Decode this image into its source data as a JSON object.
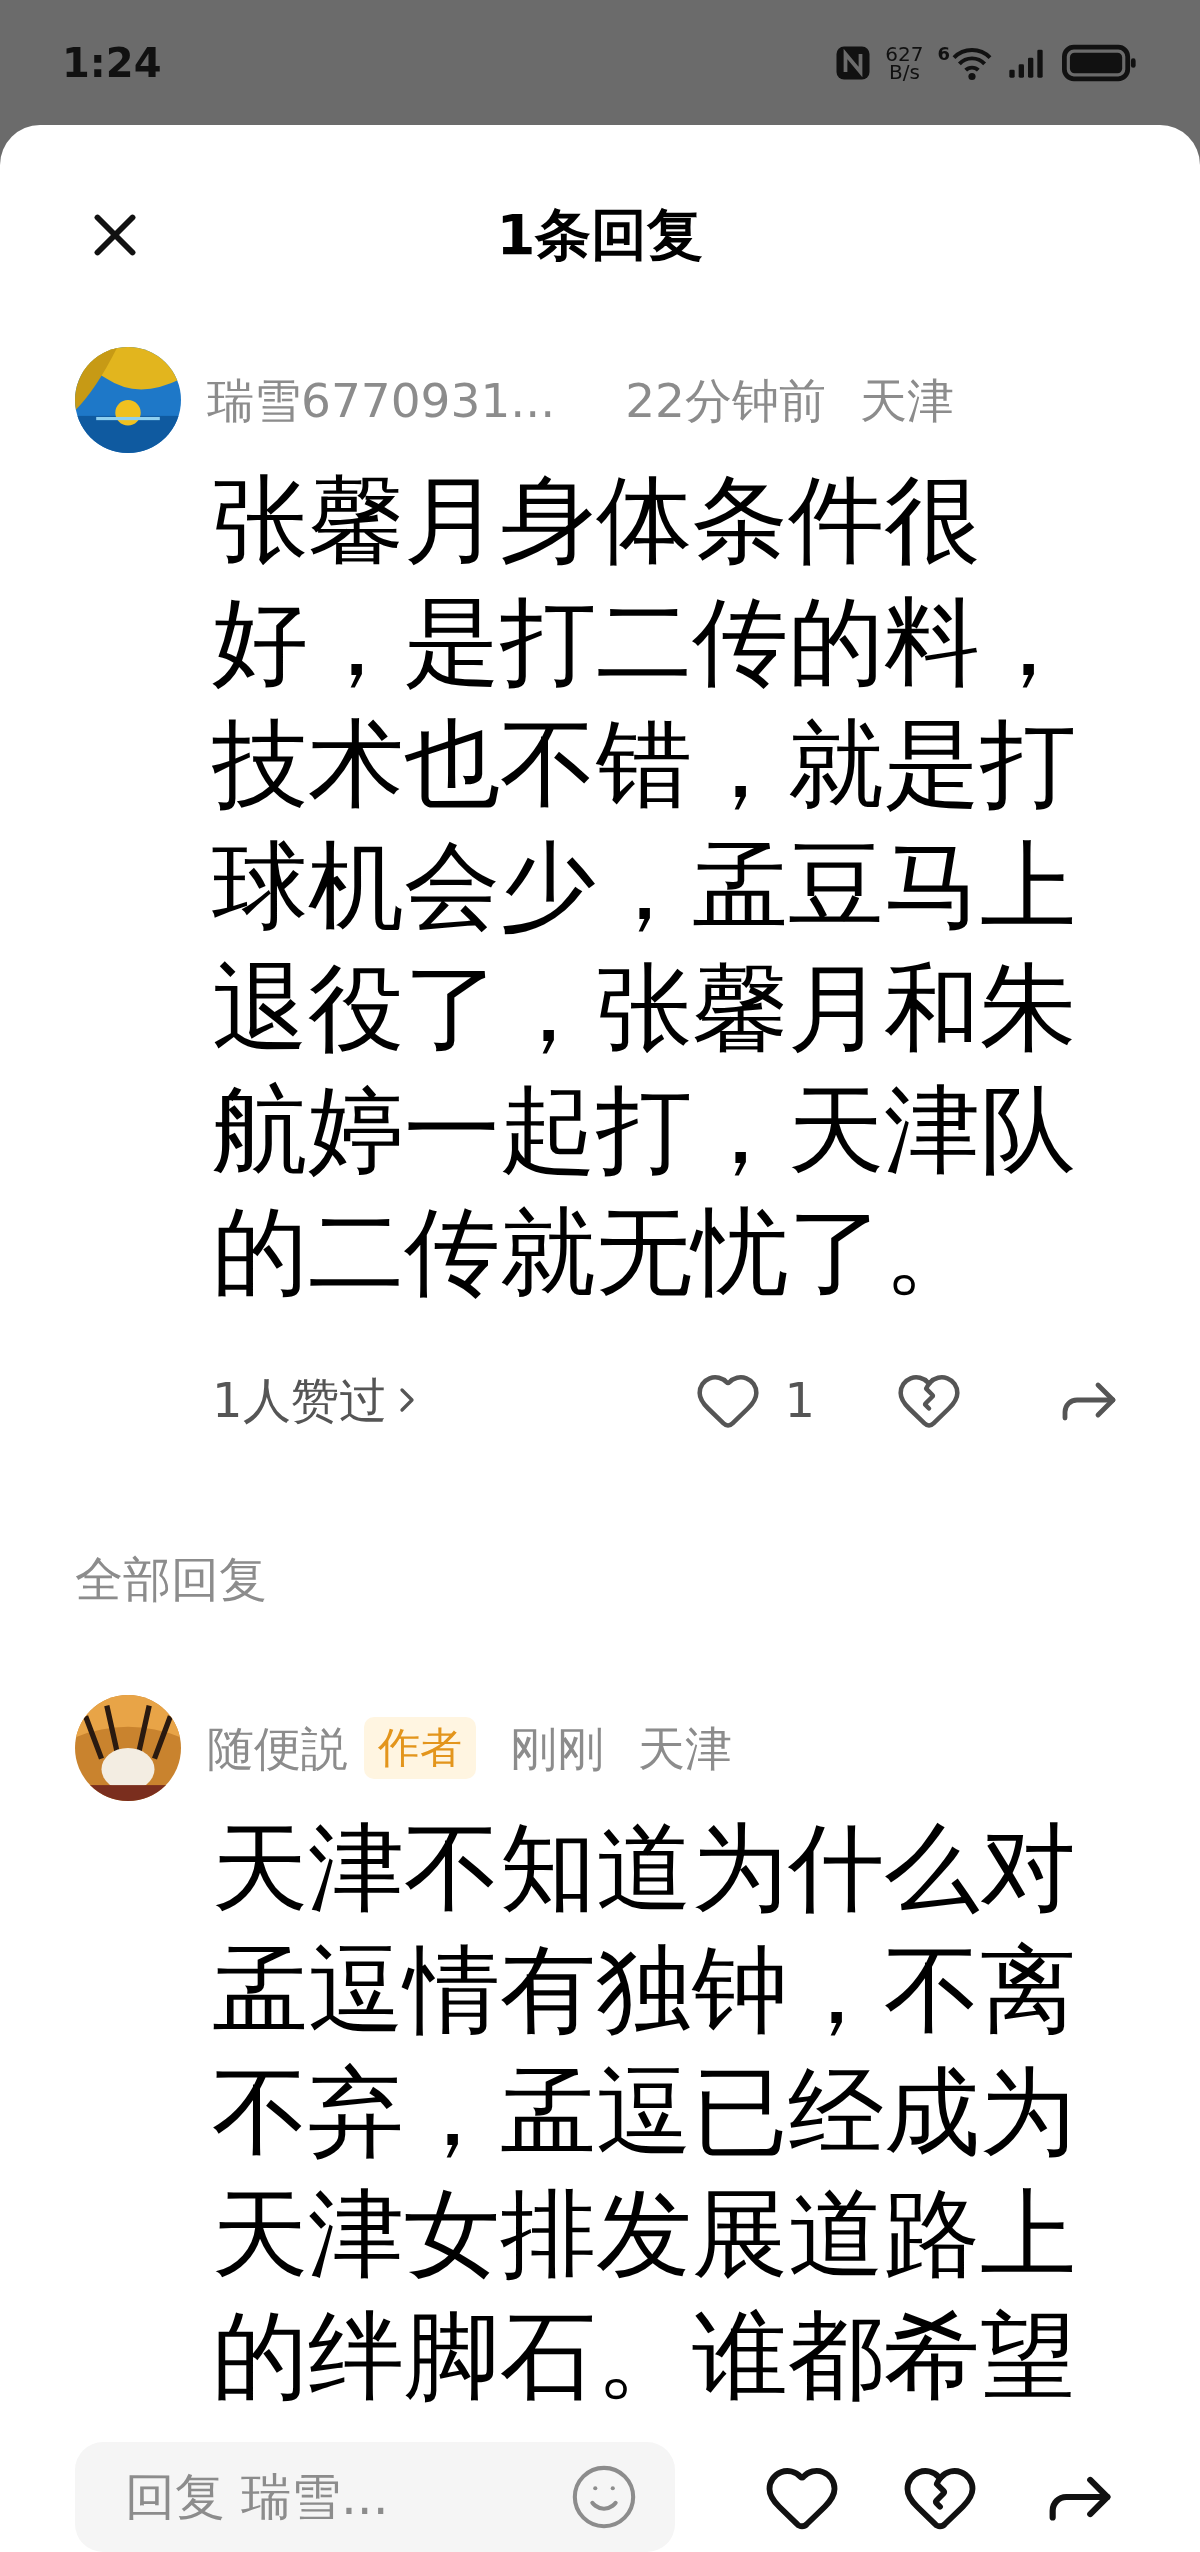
{
  "status_bar": {
    "time": "1:24",
    "net_speed_value": "627",
    "net_speed_unit": "B/s",
    "wifi_badge": "6"
  },
  "header": {
    "title": "1条回复"
  },
  "comment": {
    "username": "瑞雪6770931...",
    "time": "22分钟前",
    "location": "天津",
    "text": "张馨月身体条件很好，是打二传的料，技术也不错，就是打球机会少，孟豆马上退役了，张馨月和朱航婷一起打，天津队的二传就无忧了。",
    "likes_summary": "1人赞过",
    "like_count": "1"
  },
  "replies_heading": "全部回复",
  "replies": [
    {
      "username": "随便説",
      "badge": "作者",
      "time": "刚刚",
      "location": "天津",
      "text": "天津不知道为什么对孟逗情有独钟，不离不弃，孟逗已经成为天津女排发展道路上的绊脚石。谁都希望"
    }
  ],
  "reply_bar": {
    "placeholder": "回复 瑞雪..."
  }
}
